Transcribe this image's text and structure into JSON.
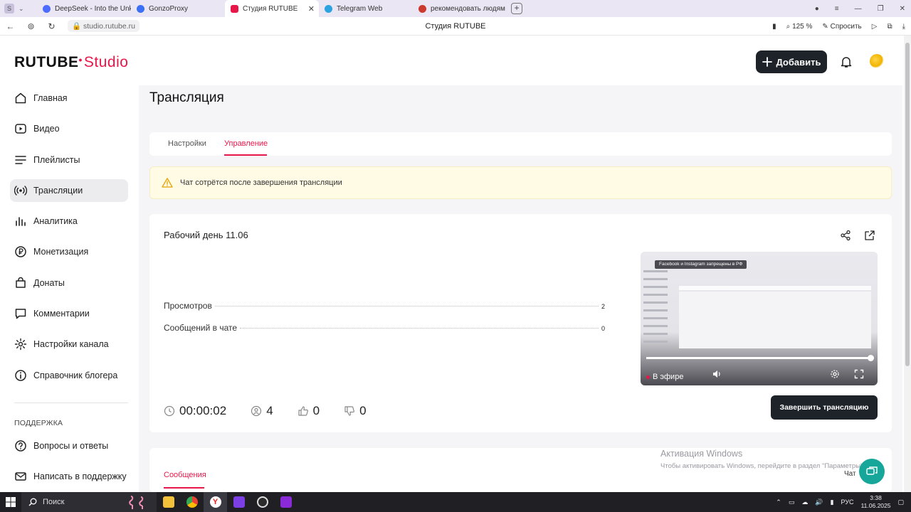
{
  "browser": {
    "tabs": [
      {
        "label": "DeepSeek - Into the Unkno",
        "color": "#4d6bfe"
      },
      {
        "label": "GonzoProxy",
        "color": "#3b6ff5"
      },
      {
        "label": "Студия RUTUBE",
        "color": "#e8174a",
        "active": true
      },
      {
        "label": "Telegram Web",
        "color": "#2aa3e0"
      },
      {
        "label": "рекомендовать людям",
        "color": "#cc3a2f"
      }
    ],
    "url": "studio.rutube.ru",
    "page_title": "Студия RUTUBE",
    "zoom": "125 %",
    "ask_label": "Спросить"
  },
  "header": {
    "logo_text": "RUTUBE",
    "logo_studio": "Studio",
    "add_label": "Добавить"
  },
  "sidebar": {
    "items": [
      {
        "label": "Главная",
        "icon": "home-icon"
      },
      {
        "label": "Видео",
        "icon": "video-icon"
      },
      {
        "label": "Плейлисты",
        "icon": "playlist-icon"
      },
      {
        "label": "Трансляции",
        "icon": "broadcast-icon",
        "active": true
      },
      {
        "label": "Аналитика",
        "icon": "analytics-icon"
      },
      {
        "label": "Монетизация",
        "icon": "ruble-icon"
      },
      {
        "label": "Донаты",
        "icon": "bag-icon"
      },
      {
        "label": "Комментарии",
        "icon": "comment-icon"
      },
      {
        "label": "Настройки канала",
        "icon": "gear-icon"
      },
      {
        "label": "Справочник блогера",
        "icon": "info-icon"
      }
    ],
    "support_label": "ПОДДЕРЖКА",
    "support_items": [
      {
        "label": "Вопросы и ответы",
        "icon": "question-icon"
      },
      {
        "label": "Написать в поддержку",
        "icon": "mail-icon"
      }
    ]
  },
  "main": {
    "title": "Трансляция",
    "tabs": [
      {
        "label": "Настройки"
      },
      {
        "label": "Управление",
        "active": true
      }
    ],
    "warning": "Чат сотрётся после завершения трансляции",
    "stream": {
      "name": "Рабочий день 11.06",
      "views_label": "Просмотров",
      "views_value": "2",
      "chat_label": "Сообщений в чате",
      "chat_value": "0",
      "duration": "00:00:02",
      "viewers": "4",
      "likes": "0",
      "dislikes": "0",
      "end_label": "Завершить трансляцию",
      "player": {
        "live_label": "В эфире",
        "banner": "Facebook и Instagram запрещены в РФ",
        "progress": 1.0
      }
    },
    "messages_tab": "Сообщения",
    "chat_tab": "Чат"
  },
  "watermark": {
    "line1": "Активация Windows",
    "line2": "Чтобы активировать Windows, перейдите в раздел \"Параметры\"."
  },
  "taskbar": {
    "search_label": "Поиск",
    "lang": "РУС",
    "time": "3:38",
    "date": "11.06.2025"
  }
}
